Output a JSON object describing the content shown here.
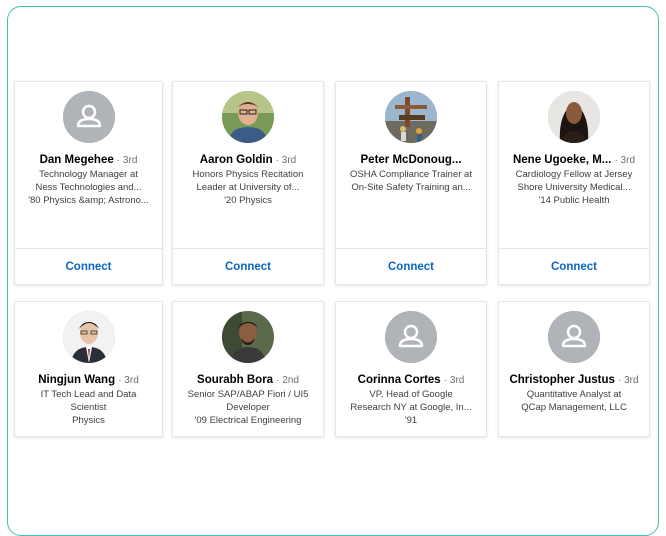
{
  "colors": {
    "frame_border": "#3fc1b0",
    "connect": "#0a66c2",
    "placeholder_avatar": "#b0b4b8"
  },
  "cards": [
    {
      "name": "Dan Megehee",
      "degree": "· 3rd",
      "lines": [
        "Technology Manager at",
        "Ness Technologies and...",
        "'80 Physics &amp; Astrono..."
      ],
      "connect": "Connect",
      "avatar": "placeholder-person-icon"
    },
    {
      "name": "Aaron Goldin",
      "degree": "· 3rd",
      "lines": [
        "Honors Physics Recitation",
        "Leader at University of...",
        "'20 Physics"
      ],
      "connect": "Connect",
      "avatar": "photo"
    },
    {
      "name": "Peter McDonoug...",
      "degree": "",
      "lines": [
        "OSHA Compliance Trainer at",
        "On-Site Safety Training an..."
      ],
      "connect": "Connect",
      "avatar": "photo"
    },
    {
      "name": "Nene Ugoeke, M...",
      "degree": "· 3rd",
      "lines": [
        "Cardiology Fellow at Jersey",
        "Shore University Medical...",
        "'14 Public Health"
      ],
      "connect": "Connect",
      "avatar": "photo"
    },
    {
      "name": "Ningjun Wang",
      "degree": "· 3rd",
      "lines": [
        "IT Tech Lead and Data",
        "Scientist",
        "Physics"
      ],
      "avatar": "photo"
    },
    {
      "name": "Sourabh Bora",
      "degree": "· 2nd",
      "lines": [
        "Senior SAP/ABAP Fiori / UI5",
        "Developer",
        "'09 Electrical Engineering"
      ],
      "avatar": "photo"
    },
    {
      "name": "Corinna Cortes",
      "degree": "· 3rd",
      "lines": [
        "VP, Head of Google",
        "Research NY at Google, In...",
        "'91"
      ],
      "avatar": "placeholder-person-icon"
    },
    {
      "name": "Christopher Justus",
      "degree": "· 3rd",
      "lines": [
        "Quantitative Analyst at",
        "QCap Management, LLC"
      ],
      "avatar": "placeholder-person-icon"
    }
  ]
}
